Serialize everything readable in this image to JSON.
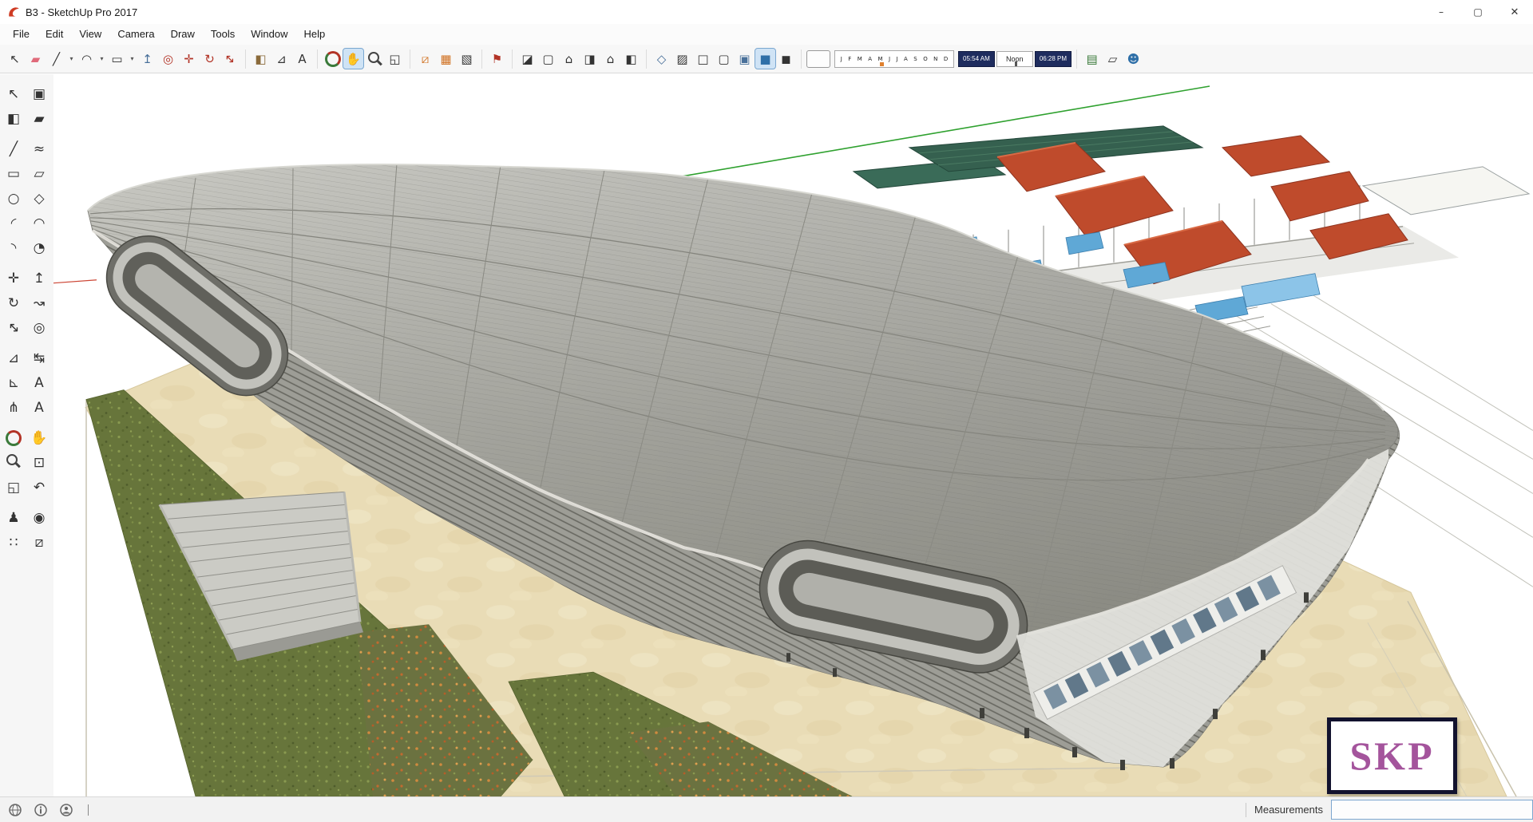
{
  "window": {
    "title": "B3 - SketchUp Pro 2017",
    "controls": {
      "minimize": "–",
      "maximize": "▢",
      "close": "✕"
    }
  },
  "menu": {
    "items": [
      "File",
      "Edit",
      "View",
      "Camera",
      "Draw",
      "Tools",
      "Window",
      "Help"
    ]
  },
  "toolbar": {
    "tools": [
      {
        "name": "select",
        "glyph": "↖"
      },
      {
        "name": "eraser",
        "glyph": "▰"
      },
      {
        "name": "line",
        "glyph": "╱"
      },
      {
        "name": "line-dropdown",
        "glyph": "▾"
      },
      {
        "name": "arc",
        "glyph": "◠"
      },
      {
        "name": "arc-dropdown",
        "glyph": "▾"
      },
      {
        "name": "shapes",
        "glyph": "▭"
      },
      {
        "name": "shapes-dropdown",
        "glyph": "▾"
      },
      {
        "name": "push-pull",
        "glyph": "↥"
      },
      {
        "name": "offset",
        "glyph": "◎"
      },
      {
        "name": "move",
        "glyph": "✛"
      },
      {
        "name": "rotate",
        "glyph": "↻"
      },
      {
        "name": "scale",
        "glyph": "↔"
      },
      {
        "name": "paint-bucket",
        "glyph": "◧"
      },
      {
        "name": "tape-measure",
        "glyph": "⊿"
      },
      {
        "name": "text",
        "glyph": "A"
      },
      {
        "name": "orbit",
        "glyph": ""
      },
      {
        "name": "pan",
        "glyph": "✋"
      },
      {
        "name": "zoom",
        "glyph": ""
      },
      {
        "name": "zoom-extents",
        "glyph": "◱"
      },
      {
        "name": "section-plane",
        "glyph": "⧄"
      },
      {
        "name": "display-section-planes",
        "glyph": "▦"
      },
      {
        "name": "display-section-cuts",
        "glyph": "▧"
      },
      {
        "name": "add-location",
        "glyph": "⚑"
      },
      {
        "name": "view-iso",
        "glyph": "◪"
      },
      {
        "name": "view-top",
        "glyph": "▢"
      },
      {
        "name": "view-front",
        "glyph": "⌂"
      },
      {
        "name": "view-right",
        "glyph": "◨"
      },
      {
        "name": "view-back",
        "glyph": "⌂"
      },
      {
        "name": "view-left",
        "glyph": "◧"
      },
      {
        "name": "style-xray",
        "glyph": "◇"
      },
      {
        "name": "style-back-edges",
        "glyph": "▨"
      },
      {
        "name": "style-wireframe",
        "glyph": "□"
      },
      {
        "name": "style-hidden-line",
        "glyph": "▢"
      },
      {
        "name": "style-shaded",
        "glyph": "▣"
      },
      {
        "name": "style-shaded-textures",
        "glyph": "■"
      },
      {
        "name": "style-monochrome",
        "glyph": "◼"
      },
      {
        "name": "shadows-toggle",
        "glyph": ""
      },
      {
        "name": "image",
        "glyph": "▤"
      },
      {
        "name": "tag",
        "glyph": "▱"
      },
      {
        "name": "account",
        "glyph": "☻"
      }
    ],
    "shadow": {
      "months": [
        "J",
        "F",
        "M",
        "A",
        "M",
        "J",
        "J",
        "A",
        "S",
        "O",
        "N",
        "D"
      ],
      "sunrise": "05:54 AM",
      "noon_label": "Noon",
      "sunset": "06:28 PM"
    }
  },
  "palette": {
    "tools": [
      {
        "name": "select",
        "glyph": "↖"
      },
      {
        "name": "make-component",
        "glyph": "▣"
      },
      {
        "name": "paint-bucket",
        "glyph": "◧"
      },
      {
        "name": "eraser",
        "glyph": "▰"
      },
      {
        "name": "line",
        "glyph": "╱"
      },
      {
        "name": "freehand",
        "glyph": "≈"
      },
      {
        "name": "rectangle",
        "glyph": "▭"
      },
      {
        "name": "rotated-rectangle",
        "glyph": "▱"
      },
      {
        "name": "circle",
        "glyph": "○"
      },
      {
        "name": "polygon",
        "glyph": "◇"
      },
      {
        "name": "arc",
        "glyph": "◜"
      },
      {
        "name": "two-point-arc",
        "glyph": "◠"
      },
      {
        "name": "three-point-arc",
        "glyph": "◝"
      },
      {
        "name": "pie",
        "glyph": "◔"
      },
      {
        "name": "move",
        "glyph": "✛"
      },
      {
        "name": "push-pull",
        "glyph": "↥"
      },
      {
        "name": "rotate",
        "glyph": "↻"
      },
      {
        "name": "follow-me",
        "glyph": "↝"
      },
      {
        "name": "scale",
        "glyph": "↔"
      },
      {
        "name": "offset",
        "glyph": "◎"
      },
      {
        "name": "tape-measure",
        "glyph": "⊿"
      },
      {
        "name": "dimension",
        "glyph": "↹"
      },
      {
        "name": "protractor",
        "glyph": "⊾"
      },
      {
        "name": "text",
        "glyph": "A"
      },
      {
        "name": "axes",
        "glyph": "⋔"
      },
      {
        "name": "3d-text",
        "glyph": "A"
      },
      {
        "name": "orbit",
        "glyph": ""
      },
      {
        "name": "pan",
        "glyph": "✋"
      },
      {
        "name": "zoom",
        "glyph": ""
      },
      {
        "name": "zoom-window",
        "glyph": "⊡"
      },
      {
        "name": "zoom-extents",
        "glyph": "◱"
      },
      {
        "name": "previous",
        "glyph": "↶"
      },
      {
        "name": "position-camera",
        "glyph": "♟"
      },
      {
        "name": "look-around",
        "glyph": "◉"
      },
      {
        "name": "walk",
        "glyph": "∷"
      },
      {
        "name": "section-plane",
        "glyph": "⧄"
      }
    ]
  },
  "viewport": {
    "watermark": "SKP"
  },
  "status_bar": {
    "measurements_label": "Measurements",
    "measurements_value": ""
  },
  "colors": {
    "ground_tan": "#e9dcb6",
    "grass_green": "#67753b",
    "flower_orange": "#c26a30",
    "roof_gray": "#a9a9a2",
    "red_roof": "#bf4b2c",
    "teal_roof": "#35604f",
    "glass_blue": "#5fa8d6",
    "axis_green": "#2fa12f",
    "axis_red": "#cc4433",
    "watermark_purple": "#a4549c",
    "shadow_time_navy": "#1e2c5e"
  }
}
